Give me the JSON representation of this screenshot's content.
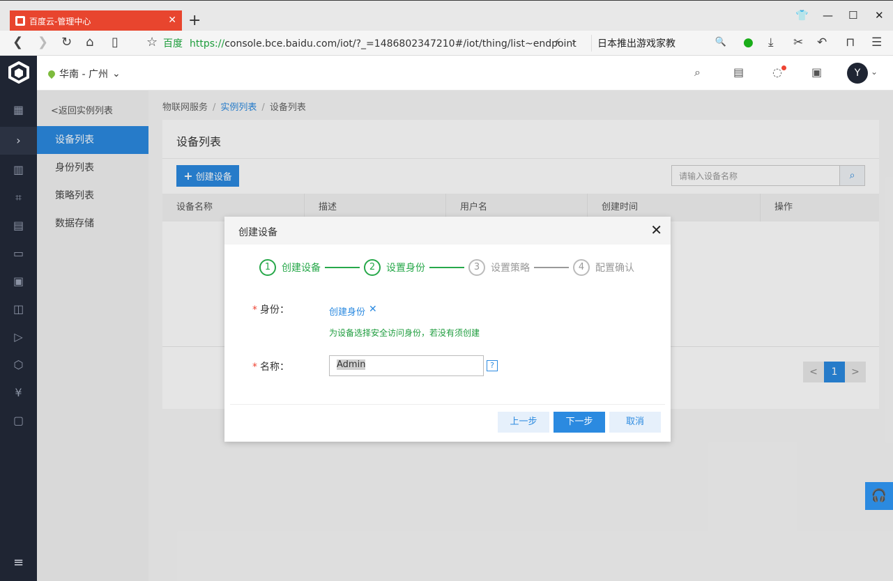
{
  "browser": {
    "tab_title": "百度云-管理中心",
    "site_name": "百度",
    "url_https": "https://",
    "url_rest": "console.bce.baidu.com/iot/?_=1486802347210#/iot/thing/list~endpoint",
    "search_text": "日本推出游戏家教"
  },
  "topbar": {
    "region": "华南 - 广州",
    "avatar_letter": "Y"
  },
  "subnav": {
    "back": "<返回实例列表",
    "items": [
      "设备列表",
      "身份列表",
      "策略列表",
      "数据存储"
    ]
  },
  "breadcrumb": {
    "root": "物联网服务",
    "mid": "实例列表",
    "current": "设备列表",
    "separator": "/"
  },
  "panel": {
    "title": "设备列表",
    "create_button": "创建设备",
    "search_placeholder": "请输入设备名称",
    "columns": [
      "设备名称",
      "描述",
      "用户名",
      "创建时间",
      "操作"
    ],
    "pager": {
      "prev": "<",
      "current": "1",
      "next": ">"
    }
  },
  "modal": {
    "title": "创建设备",
    "steps": [
      {
        "num": "1",
        "label": "创建设备",
        "done": true
      },
      {
        "num": "2",
        "label": "设置身份",
        "done": true
      },
      {
        "num": "3",
        "label": "设置策略",
        "done": false
      },
      {
        "num": "4",
        "label": "配置确认",
        "done": false
      }
    ],
    "identity_label": "身份：",
    "identity_value": "创建身份",
    "identity_hint": "为设备选择安全访问身份，若没有须创建",
    "name_label": "名称：",
    "name_value": "Admin",
    "help_mark": "?",
    "buttons": {
      "prev": "上一步",
      "next": "下一步",
      "cancel": "取消"
    }
  },
  "colors": {
    "accent": "#2b8ae0",
    "success": "#27a84a",
    "sidebar": "#1f2533",
    "tab": "#e8452e"
  }
}
